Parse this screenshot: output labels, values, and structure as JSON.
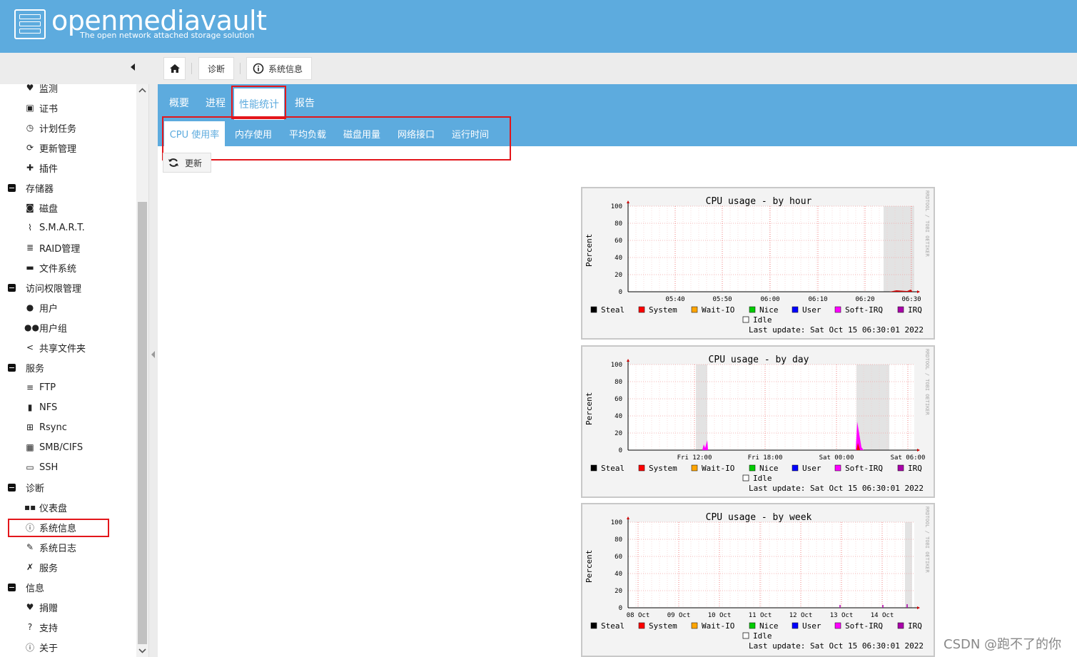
{
  "header": {
    "logo_name": "openmediavault",
    "logo_sub": "The open network attached storage solution"
  },
  "breadcrumb": {
    "items": [
      "诊断",
      "系统信息"
    ]
  },
  "sidebar": {
    "items": [
      {
        "label": "监测",
        "icon": "heartbeat-icon"
      },
      {
        "label": "证书",
        "icon": "certificate-icon"
      },
      {
        "label": "计划任务",
        "icon": "calendar-clock-icon"
      },
      {
        "label": "更新管理",
        "icon": "refresh-icon"
      },
      {
        "label": "插件",
        "icon": "puzzle-icon"
      },
      {
        "label": "存储器",
        "section": true
      },
      {
        "label": "磁盘",
        "icon": "disk-icon"
      },
      {
        "label": "S.M.A.R.T.",
        "icon": "pulse-icon"
      },
      {
        "label": "RAID管理",
        "icon": "database-icon"
      },
      {
        "label": "文件系统",
        "icon": "folder-icon"
      },
      {
        "label": "访问权限管理",
        "section": true
      },
      {
        "label": "用户",
        "icon": "user-icon"
      },
      {
        "label": "用户组",
        "icon": "users-icon"
      },
      {
        "label": "共享文件夹",
        "icon": "share-icon"
      },
      {
        "label": "服务",
        "section": true
      },
      {
        "label": "FTP",
        "icon": "server-icon"
      },
      {
        "label": "NFS",
        "icon": "network-drive-icon"
      },
      {
        "label": "Rsync",
        "icon": "sitemap-icon"
      },
      {
        "label": "SMB/CIFS",
        "icon": "windows-icon"
      },
      {
        "label": "SSH",
        "icon": "terminal-icon"
      },
      {
        "label": "诊断",
        "section": true
      },
      {
        "label": "仪表盘",
        "icon": "dashboard-icon"
      },
      {
        "label": "系统信息",
        "icon": "info-icon"
      },
      {
        "label": "系统日志",
        "icon": "edit-icon"
      },
      {
        "label": "服务",
        "icon": "wrench-icon"
      },
      {
        "label": "信息",
        "section": true
      },
      {
        "label": "捐赠",
        "icon": "heart-icon"
      },
      {
        "label": "支持",
        "icon": "question-icon"
      },
      {
        "label": "关于",
        "icon": "info-icon"
      }
    ]
  },
  "tabs_main": [
    "概要",
    "进程",
    "性能统计",
    "报告"
  ],
  "tabs_sub": [
    "CPU 使用率",
    "内存使用",
    "平均负载",
    "磁盘用量",
    "网络接口",
    "运行时间"
  ],
  "toolbar": {
    "refresh_label": "更新"
  },
  "graph_common": {
    "ylabel": "Percent",
    "yticks": [
      "100",
      "80",
      "60",
      "40",
      "20",
      "0"
    ],
    "legend": [
      {
        "label": "Steal",
        "color": "#000000"
      },
      {
        "label": "System",
        "color": "#ff0000"
      },
      {
        "label": "Wait-IO",
        "color": "#ffa500"
      },
      {
        "label": "Nice",
        "color": "#00cc00"
      },
      {
        "label": "User",
        "color": "#0000ff"
      },
      {
        "label": "Soft-IRQ",
        "color": "#ff00ff"
      },
      {
        "label": "IRQ",
        "color": "#aa00aa"
      }
    ],
    "idle_label": "Idle",
    "last_update": "Last update: Sat Oct 15 06:30:01 2022",
    "side_text": "RRDTOOL / TOBI OETIKER"
  },
  "graphs": [
    {
      "title": "CPU usage - by hour",
      "xticks": [
        "05:40",
        "05:50",
        "06:00",
        "06:10",
        "06:20",
        "06:30"
      ]
    },
    {
      "title": "CPU usage - by day",
      "xticks": [
        "Fri 12:00",
        "Fri 18:00",
        "Sat 00:00",
        "Sat 06:00"
      ]
    },
    {
      "title": "CPU usage - by week",
      "xticks": [
        "08 Oct",
        "09 Oct",
        "10 Oct",
        "11 Oct",
        "12 Oct",
        "13 Oct",
        "14 Oct"
      ]
    }
  ],
  "watermark": "CSDN @跑不了的你"
}
